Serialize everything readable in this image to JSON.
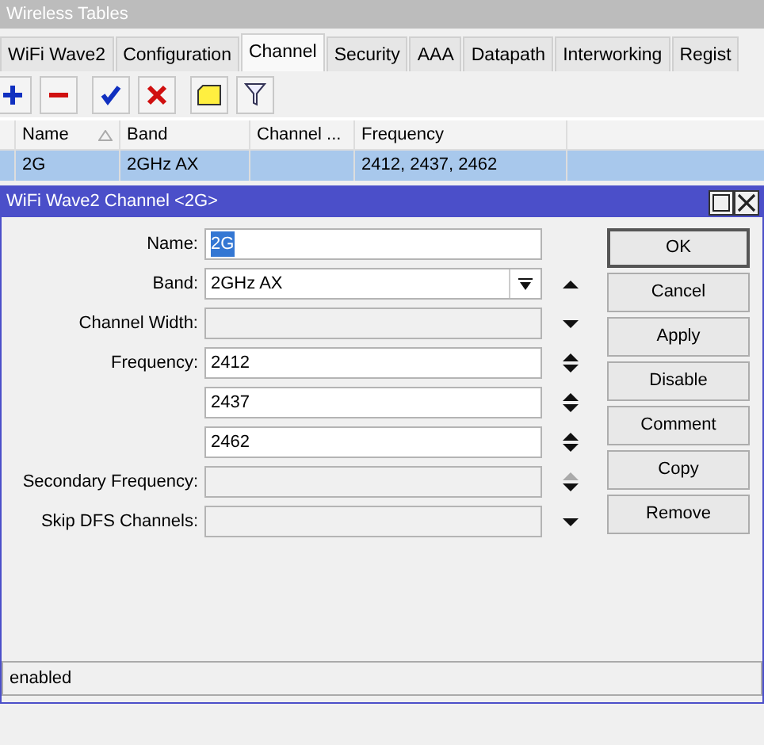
{
  "background_window": {
    "title": "Wireless Tables"
  },
  "tabs": [
    {
      "label": "WiFi Wave2",
      "selected": false
    },
    {
      "label": "Configuration",
      "selected": false
    },
    {
      "label": "Channel",
      "selected": true
    },
    {
      "label": "Security",
      "selected": false
    },
    {
      "label": "AAA",
      "selected": false
    },
    {
      "label": "Datapath",
      "selected": false
    },
    {
      "label": "Interworking",
      "selected": false
    },
    {
      "label": "Regist",
      "selected": false
    }
  ],
  "toolbar": [
    {
      "kind": "add"
    },
    {
      "kind": "remove"
    },
    {
      "kind": "enable"
    },
    {
      "kind": "disable"
    },
    {
      "kind": "comment"
    },
    {
      "kind": "filter"
    }
  ],
  "table": {
    "columns": [
      {
        "label": "Name",
        "sorted": true
      },
      {
        "label": "Band",
        "sorted": false
      },
      {
        "label": "Channel ...",
        "sorted": false
      },
      {
        "label": "Frequency",
        "sorted": false
      }
    ],
    "rows": [
      {
        "cells": [
          "2G",
          "2GHz AX",
          "",
          "2412, 2437, 2462"
        ],
        "selected": true
      }
    ]
  },
  "dialog": {
    "title": "WiFi Wave2 Channel <2G>",
    "fields": [
      {
        "label": "Name:",
        "value": "2G",
        "highlighted": true,
        "disabled": false
      },
      {
        "label": "Band:",
        "value": "2GHz AX",
        "highlighted": false,
        "disabled": false,
        "kind": "collapse"
      },
      {
        "label": "Channel Width:",
        "disabled": true,
        "kind": "expand"
      },
      {
        "label": "Frequency:",
        "value": "2412",
        "highlighted": false,
        "disabled": false,
        "kind": "updown"
      },
      {
        "value": "2437",
        "highlighted": false,
        "disabled": false,
        "kind": "updown"
      },
      {
        "value": "2462",
        "highlighted": false,
        "disabled": false,
        "kind": "updown"
      },
      {
        "label": "Secondary Frequency:",
        "disabled": true,
        "kind": "updown-partial"
      },
      {
        "label": "Skip DFS Channels:",
        "disabled": true,
        "kind": "expand"
      }
    ],
    "buttons": [
      "OK",
      "Cancel",
      "Apply",
      "Disable",
      "Comment",
      "Copy",
      "Remove"
    ],
    "status_bar": "enabled"
  }
}
